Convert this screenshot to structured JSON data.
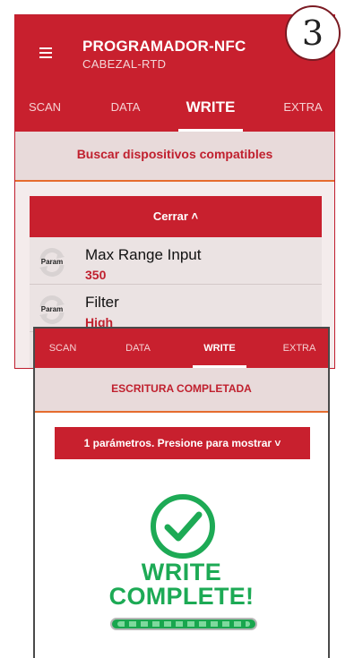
{
  "back_screen": {
    "app_title": "PROGRAMADOR-NFC",
    "app_subtitle": "CABEZAL-RTD",
    "step_number": "3",
    "tabs": [
      {
        "label": "SCAN",
        "active": false
      },
      {
        "label": "DATA",
        "active": false
      },
      {
        "label": "WRITE",
        "active": true
      },
      {
        "label": "EXTRA",
        "active": false
      }
    ],
    "search_button": "Buscar dispositivos compatibles",
    "collapse_button": "Cerrar ˄",
    "params": [
      {
        "icon_label": "Param",
        "name": "Max Range Input",
        "value": "350"
      },
      {
        "icon_label": "Param",
        "name": "Filter",
        "value": "High"
      }
    ]
  },
  "front_screen": {
    "tabs": [
      {
        "label": "SCAN",
        "active": false
      },
      {
        "label": "DATA",
        "active": false
      },
      {
        "label": "WRITE",
        "active": true
      },
      {
        "label": "EXTRA",
        "active": false
      }
    ],
    "status_text": "ESCRITURA COMPLETADA",
    "params_button": "1 parámetros. Presione para mostrar ˅",
    "write_line1": "WRITE",
    "write_line2": "COMPLETE!",
    "progress_fraction": 1.0
  },
  "colors": {
    "brand_red": "#c8202e",
    "accent_orange": "#e56c2e",
    "success_green": "#1daa55"
  },
  "icons": [
    "menu-icon",
    "param-refresh-icon",
    "check-circle-icon"
  ]
}
